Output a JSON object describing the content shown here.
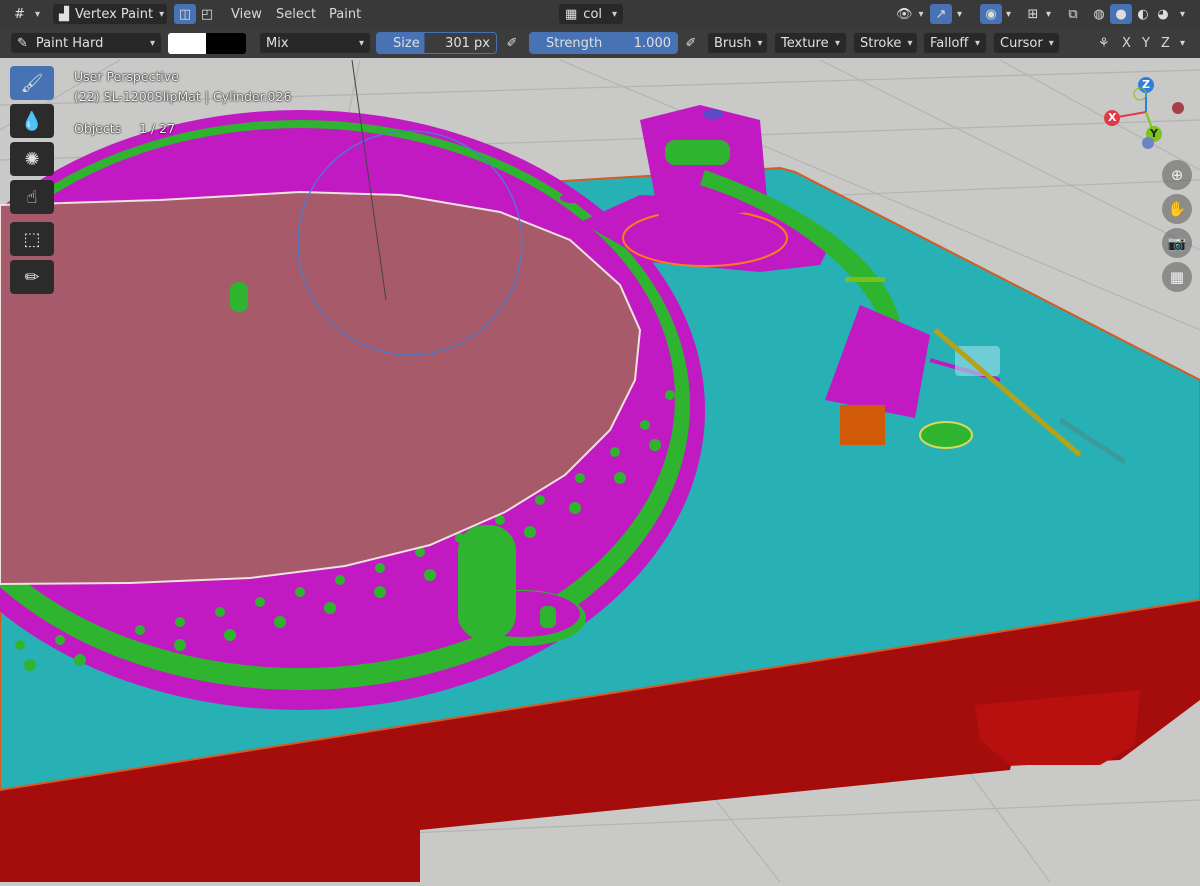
{
  "header": {
    "editor_icon": "grid-icon",
    "mode_label": "Vertex Paint",
    "menus": [
      "View",
      "Select",
      "Paint"
    ],
    "color_attribute": "col",
    "axes": [
      "X",
      "Y",
      "Z"
    ]
  },
  "tool_header": {
    "brush_name": "Paint Hard",
    "primary_color": "#ffffff",
    "secondary_color": "#000000",
    "blend_mode": "Mix",
    "size_label": "Size",
    "size_value": "301 px",
    "strength_label": "Strength",
    "strength_value": "1.000",
    "popovers": [
      "Brush",
      "Texture",
      "Stroke",
      "Falloff",
      "Cursor"
    ]
  },
  "viewport": {
    "view_name": "User Perspective",
    "object_info": "(22) SL-1200SlipMat | Cylinder.026",
    "objects_label": "Objects",
    "objects_count": "1 / 27"
  },
  "gizmo": {
    "z_label": "Z",
    "x_label": "X",
    "y_label": "Y"
  },
  "colors": {
    "accent": "#4772b3",
    "plinth_top": "#27b1b5",
    "plinth_side": "#a50d0d",
    "platter": "#a75a6a",
    "magenta": "#c21ac2",
    "green": "#2fb42f"
  }
}
